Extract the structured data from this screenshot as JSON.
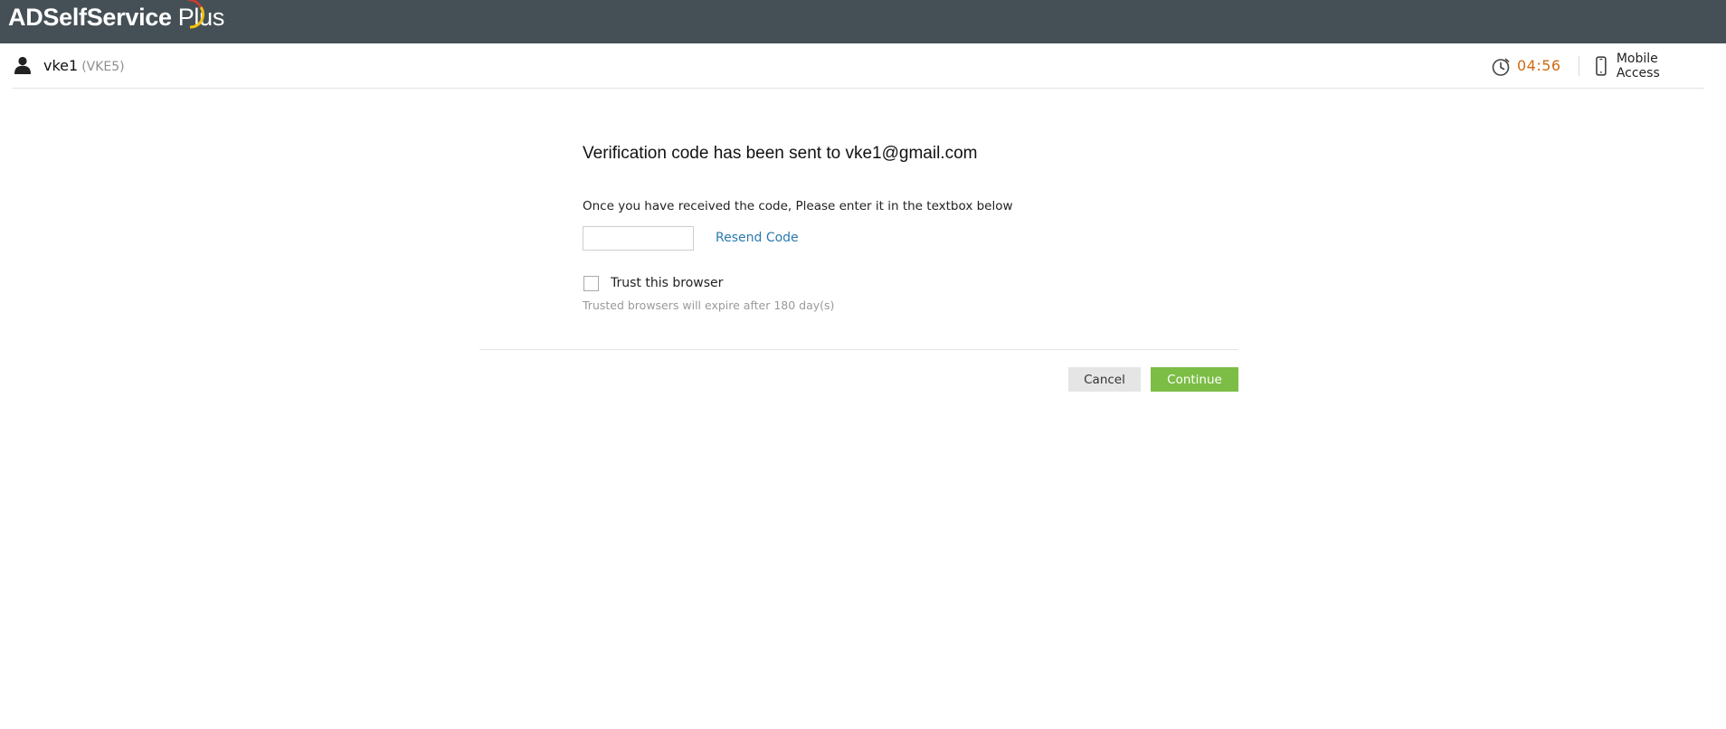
{
  "header": {
    "brand_bold": "ADSelfService",
    "brand_light": "Plus",
    "colors": {
      "bar": "#455056",
      "arc_red": "#d33a2c",
      "arc_yellow": "#f4c20d"
    }
  },
  "userbar": {
    "username": "vke1",
    "user_id": "(VKE5)",
    "timer": "04:56",
    "mobile_access": "Mobile Access",
    "icons": [
      "user-icon",
      "clock-icon",
      "mobile-phone-icon"
    ]
  },
  "verification": {
    "headline": "Verification code has been sent to vke1@gmail.com",
    "instruction": "Once you have received the code, Please enter it in the textbox below",
    "code_value": "",
    "resend_label": "Resend Code",
    "trust_label": "Trust this browser",
    "trust_checked": false,
    "trust_hint": "Trusted browsers will expire after 180 day(s)"
  },
  "actions": {
    "cancel_label": "Cancel",
    "continue_label": "Continue",
    "colors": {
      "continue": "#7cbd45",
      "cancel": "#e5e5e5",
      "timer": "#d06a13",
      "link": "#2a7ab0"
    }
  }
}
